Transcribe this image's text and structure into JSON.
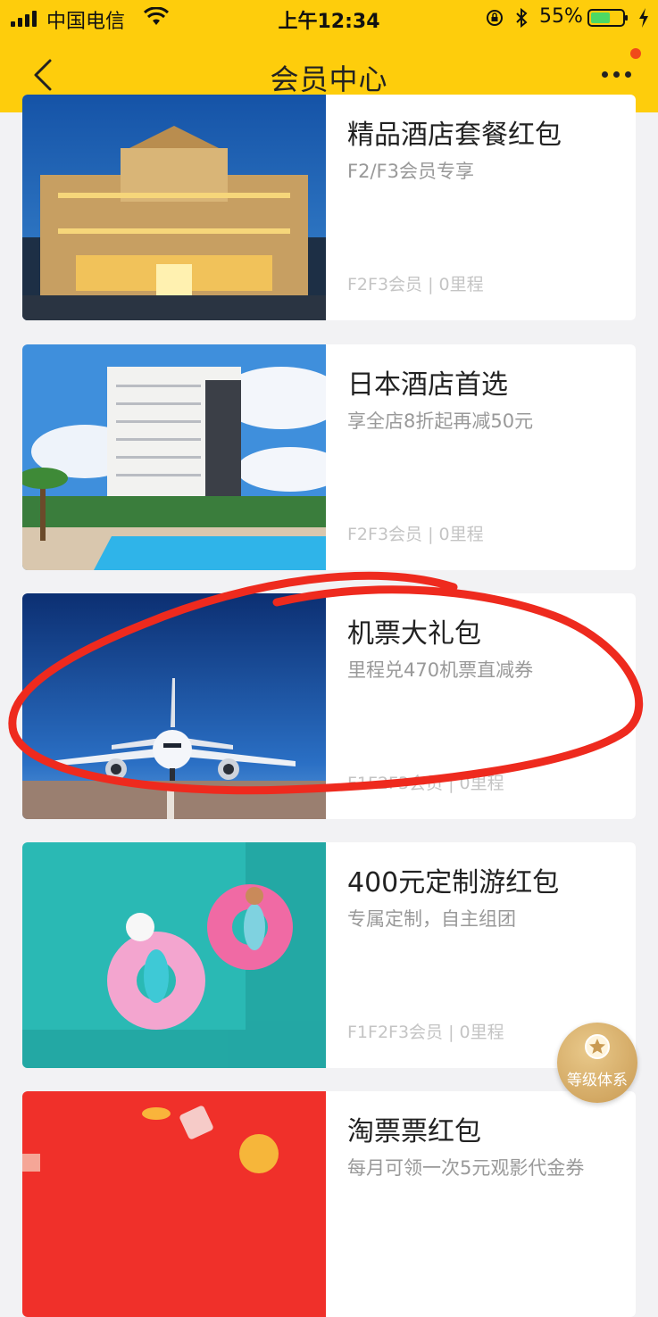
{
  "status_bar": {
    "carrier": "中国电信",
    "time": "上午12:34",
    "battery_percent": "55%"
  },
  "nav": {
    "title": "会员中心"
  },
  "cards": [
    {
      "title": "精品酒店套餐红包",
      "desc": "F2/F3会员专享",
      "meta": "F2F3会员 | 0里程",
      "image": "luxury-hotel-photo"
    },
    {
      "title": "日本酒店首选",
      "desc": "享全店8折起再减50元",
      "meta": "F2F3会员 | 0里程",
      "image": "japan-hotel-pool-photo"
    },
    {
      "title": "机票大礼包",
      "desc": "里程兑470机票直减券",
      "meta": "F1F2F3会员 | 0里程",
      "image": "airplane-photo"
    },
    {
      "title": "400元定制游红包",
      "desc": "专属定制，自主组团",
      "meta": "F1F2F3会员 | 0里程",
      "image": "pool-float-photo"
    },
    {
      "title": "淘票票红包",
      "desc": "每月可领一次5元观影代金券",
      "meta": "",
      "image": "red-movie-coupon-photo"
    }
  ],
  "level_badge": {
    "label": "等级体系"
  },
  "colors": {
    "header": "#fecd0c",
    "annotation": "#ee2a1e",
    "notification_dot": "#f04a1a"
  }
}
